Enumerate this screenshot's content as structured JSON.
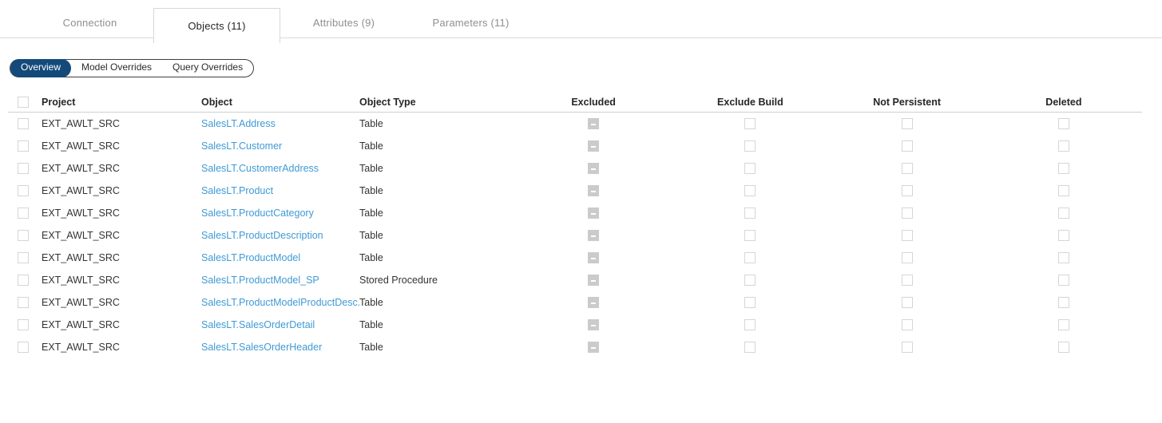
{
  "tabs": [
    {
      "label": "Connection",
      "active": false
    },
    {
      "label": "Objects (11)",
      "active": true
    },
    {
      "label": "Attributes (9)",
      "active": false
    },
    {
      "label": "Parameters (11)",
      "active": false
    }
  ],
  "segmented": [
    {
      "label": "Overview",
      "selected": true
    },
    {
      "label": "Model Overrides",
      "selected": false
    },
    {
      "label": "Query Overrides",
      "selected": false
    }
  ],
  "table": {
    "columns": {
      "project": "Project",
      "object": "Object",
      "object_type": "Object Type",
      "excluded": "Excluded",
      "exclude_build": "Exclude Build",
      "not_persistent": "Not Persistent",
      "deleted": "Deleted"
    },
    "rows": [
      {
        "project": "EXT_AWLT_SRC",
        "object": "SalesLT.Address",
        "type": "Table",
        "excluded": "indeterminate",
        "exclude_build": "unchecked",
        "not_persistent": "unchecked",
        "deleted": "unchecked"
      },
      {
        "project": "EXT_AWLT_SRC",
        "object": "SalesLT.Customer",
        "type": "Table",
        "excluded": "indeterminate",
        "exclude_build": "unchecked",
        "not_persistent": "unchecked",
        "deleted": "unchecked"
      },
      {
        "project": "EXT_AWLT_SRC",
        "object": "SalesLT.CustomerAddress",
        "type": "Table",
        "excluded": "indeterminate",
        "exclude_build": "unchecked",
        "not_persistent": "unchecked",
        "deleted": "unchecked"
      },
      {
        "project": "EXT_AWLT_SRC",
        "object": "SalesLT.Product",
        "type": "Table",
        "excluded": "indeterminate",
        "exclude_build": "unchecked",
        "not_persistent": "unchecked",
        "deleted": "unchecked"
      },
      {
        "project": "EXT_AWLT_SRC",
        "object": "SalesLT.ProductCategory",
        "type": "Table",
        "excluded": "indeterminate",
        "exclude_build": "unchecked",
        "not_persistent": "unchecked",
        "deleted": "unchecked"
      },
      {
        "project": "EXT_AWLT_SRC",
        "object": "SalesLT.ProductDescription",
        "type": "Table",
        "excluded": "indeterminate",
        "exclude_build": "unchecked",
        "not_persistent": "unchecked",
        "deleted": "unchecked"
      },
      {
        "project": "EXT_AWLT_SRC",
        "object": "SalesLT.ProductModel",
        "type": "Table",
        "excluded": "indeterminate",
        "exclude_build": "unchecked",
        "not_persistent": "unchecked",
        "deleted": "unchecked"
      },
      {
        "project": "EXT_AWLT_SRC",
        "object": "SalesLT.ProductModel_SP",
        "type": "Stored Procedure",
        "excluded": "indeterminate",
        "exclude_build": "unchecked",
        "not_persistent": "unchecked",
        "deleted": "unchecked"
      },
      {
        "project": "EXT_AWLT_SRC",
        "object": "SalesLT.ProductModelProductDesc...",
        "type": "Table",
        "excluded": "indeterminate",
        "exclude_build": "unchecked",
        "not_persistent": "unchecked",
        "deleted": "unchecked"
      },
      {
        "project": "EXT_AWLT_SRC",
        "object": "SalesLT.SalesOrderDetail",
        "type": "Table",
        "excluded": "indeterminate",
        "exclude_build": "unchecked",
        "not_persistent": "unchecked",
        "deleted": "unchecked"
      },
      {
        "project": "EXT_AWLT_SRC",
        "object": "SalesLT.SalesOrderHeader",
        "type": "Table",
        "excluded": "indeterminate",
        "exclude_build": "unchecked",
        "not_persistent": "unchecked",
        "deleted": "unchecked"
      }
    ]
  },
  "colors": {
    "accent_selected": "#134a7a",
    "link": "#3f9ad6",
    "tab_inactive_text": "#8f8f8f",
    "tab_active_text": "#262626",
    "border": "#d9d9d9",
    "checkbox_indeterminate_fill": "#cbcbcb"
  }
}
